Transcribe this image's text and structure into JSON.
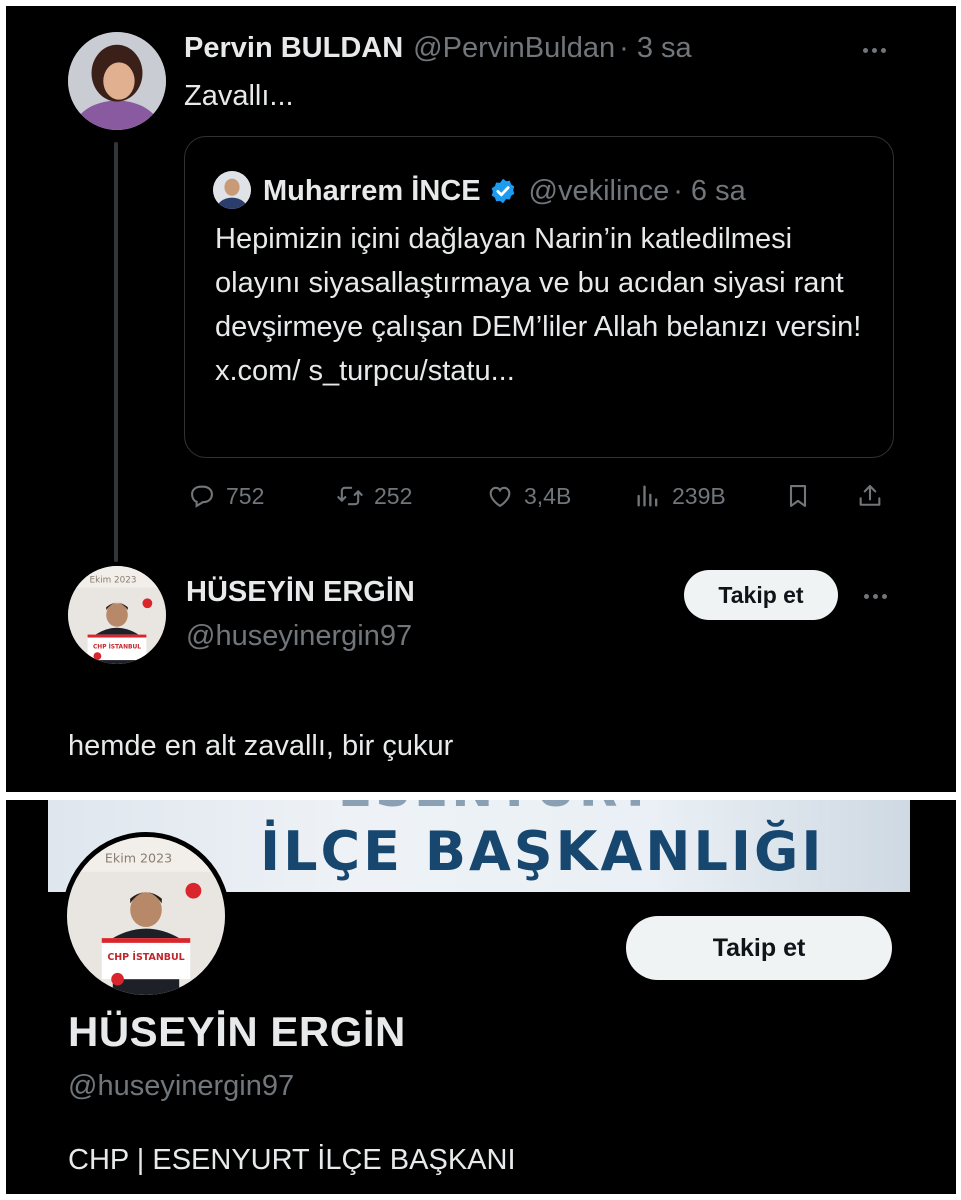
{
  "top_post": {
    "author": {
      "name": "Pervin BULDAN",
      "handle": "@PervinBuldan",
      "time": "· 3 sa"
    },
    "text": "Zavallı...",
    "quoted": {
      "author": {
        "name": "Muharrem İNCE",
        "handle": "@vekilince",
        "time": "· 6 sa"
      },
      "verified": true,
      "text": "Hepimizin içini dağlayan Narin’in katledilmesi olayını siyasallaştırmaya ve bu acıdan siyasi rant devşirmeye çalışan DEM’liler Allah belanızı versin! x.com/ s_turpcu/statu..."
    },
    "actions": {
      "replies": "752",
      "reposts": "252",
      "likes": "3,4B",
      "views": "239B"
    }
  },
  "reply": {
    "author": {
      "name": "HÜSEYİN ERGİN",
      "handle": "@huseyinergin97"
    },
    "follow_label": "Takip et",
    "text": "hemde en alt zavallı, bir çukur",
    "avatar_caption": "Ekim 2023"
  },
  "profile": {
    "banner_text": "İLÇE BAŞKANLIĞI",
    "banner_text_partial": "ESENYURT",
    "name": "HÜSEYİN ERGİN",
    "handle": "@huseyinergin97",
    "follow_label": "Takip et",
    "bio": "CHP | ESENYURT İLÇE BAŞKANI",
    "avatar_caption": "Ekim 2023",
    "avatar_sign": "CHP İSTANBUL"
  },
  "colors": {
    "background": "#000000",
    "text": "#e7e9ea",
    "muted": "#71767b",
    "verified": "#1d9bf0",
    "button_bg": "#eff3f4",
    "banner_text": "#17476f"
  },
  "icons": [
    "reply-icon",
    "repost-icon",
    "like-icon",
    "views-icon",
    "bookmark-icon",
    "share-icon",
    "more-icon",
    "verified-icon"
  ]
}
